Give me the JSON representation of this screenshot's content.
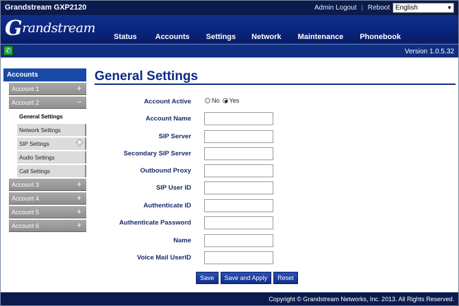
{
  "header": {
    "model": "Grandstream GXP2120",
    "admin_logout": "Admin Logout",
    "separator": "|",
    "reboot": "Reboot",
    "language": "English",
    "logo_text": "randstream",
    "logo_initial": "G",
    "version": "Version 1.0.5.32"
  },
  "menu": [
    {
      "label": "Status"
    },
    {
      "label": "Accounts"
    },
    {
      "label": "Settings"
    },
    {
      "label": "Network"
    },
    {
      "label": "Maintenance"
    },
    {
      "label": "Phonebook"
    }
  ],
  "sidebar": {
    "heading": "Accounts",
    "account1": {
      "label": "Account 1",
      "toggle": "+"
    },
    "account2": {
      "label": "Account 2",
      "toggle": "−"
    },
    "subitems": [
      {
        "label": "General Settings"
      },
      {
        "label": "Network Settings"
      },
      {
        "label": "SIP Settings"
      },
      {
        "label": "Audio Settings"
      },
      {
        "label": "Call Settings"
      }
    ],
    "others": [
      {
        "label": "Account 3",
        "toggle": "+"
      },
      {
        "label": "Account 4",
        "toggle": "+"
      },
      {
        "label": "Account 5",
        "toggle": "+"
      },
      {
        "label": "Account 6",
        "toggle": "+"
      }
    ]
  },
  "page": {
    "title": "General Settings",
    "account_active": {
      "label": "Account Active",
      "no": "No",
      "yes": "Yes",
      "selected": "Yes"
    },
    "fields": [
      {
        "label": "Account Name",
        "value": ""
      },
      {
        "label": "SIP Server",
        "value": ""
      },
      {
        "label": "Secondary SIP Server",
        "value": ""
      },
      {
        "label": "Outbound Proxy",
        "value": ""
      },
      {
        "label": "SIP User ID",
        "value": ""
      },
      {
        "label": "Authenticate ID",
        "value": ""
      },
      {
        "label": "Authenticate Password",
        "value": ""
      },
      {
        "label": "Name",
        "value": ""
      },
      {
        "label": "Voice Mail UserID",
        "value": ""
      }
    ],
    "buttons": {
      "save": "Save",
      "save_apply": "Save and Apply",
      "reset": "Reset"
    }
  },
  "footer": {
    "copyright": "Copyright © Grandstream Networks, Inc. 2013. All Rights Reserved."
  },
  "colors": {
    "navy": "#0c1b4d",
    "brand_blue": "#0f2f8a",
    "title_blue": "#0c2a86",
    "phone_green": "#1f9e3a"
  }
}
